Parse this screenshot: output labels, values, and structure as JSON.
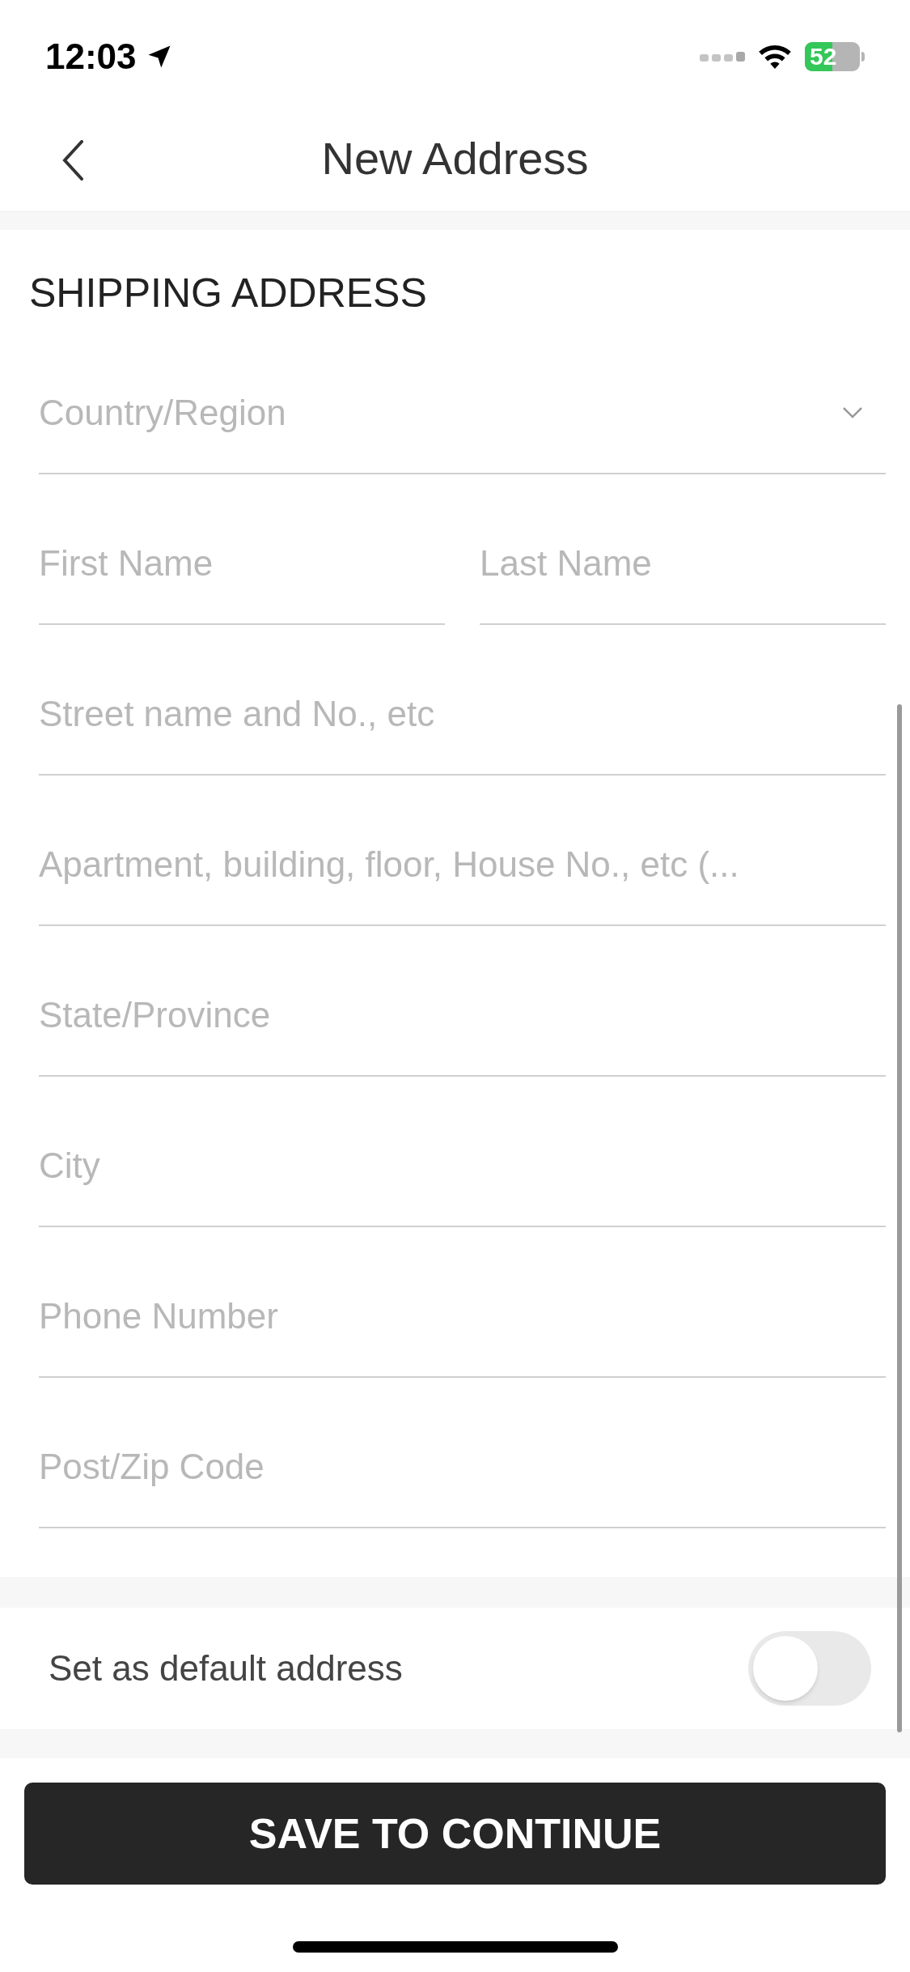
{
  "status_bar": {
    "time": "12:03",
    "battery": "52"
  },
  "nav": {
    "title": "New Address"
  },
  "section": {
    "title": "SHIPPING ADDRESS"
  },
  "rows": [
    {
      "kind": "select",
      "placeholder": "Country/Region"
    },
    {
      "kind": "pair",
      "fields": [
        {
          "placeholder": "First Name"
        },
        {
          "placeholder": "Last Name"
        }
      ]
    },
    {
      "kind": "text",
      "placeholder": "Street name and No., etc"
    },
    {
      "kind": "text",
      "placeholder": "Apartment, building, floor, House No., etc (..."
    },
    {
      "kind": "text",
      "placeholder": "State/Province"
    },
    {
      "kind": "text",
      "placeholder": "City"
    },
    {
      "kind": "text",
      "placeholder": "Phone Number"
    },
    {
      "kind": "text",
      "placeholder": "Post/Zip Code"
    }
  ],
  "default_address": {
    "label": "Set as default address",
    "on": false
  },
  "save_button": "SAVE TO CONTINUE"
}
